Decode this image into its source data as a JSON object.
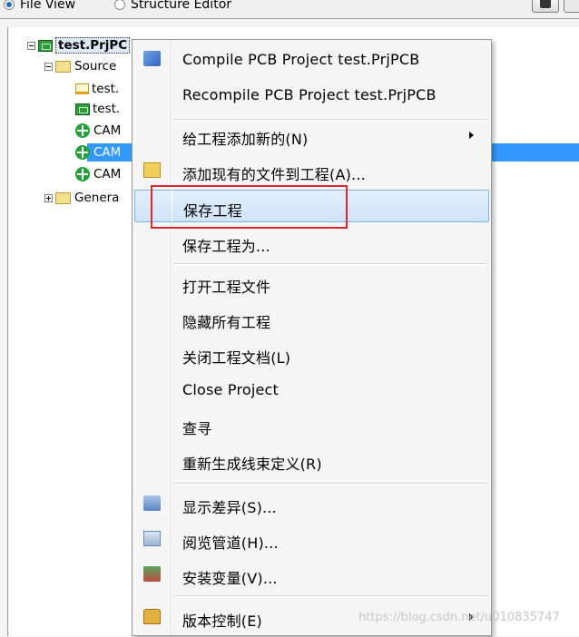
{
  "view_toggle": {
    "file_view": "File View",
    "structure_editor": "Structure Editor",
    "selected": "File View"
  },
  "tree": {
    "project": "test.PrjPC",
    "source_folder": "Source",
    "items": [
      "test.",
      "test.",
      "CAM",
      "CAM",
      "CAM"
    ],
    "generated_folder": "Genera"
  },
  "context_menu": {
    "items": [
      {
        "label": "Compile PCB Project test.PrjPCB",
        "icon": "compile-icon"
      },
      {
        "label": "Recompile PCB Project test.PrjPCB"
      },
      {
        "label": "给工程添加新的(N)",
        "submenu": true
      },
      {
        "label": "添加现有的文件到工程(A)...",
        "icon": "add-existing-icon"
      },
      {
        "label": "保存工程",
        "highlighted": true
      },
      {
        "label": "保存工程为..."
      },
      {
        "label": "打开工程文件"
      },
      {
        "label": "隐藏所有工程"
      },
      {
        "label": "关闭工程文档(L)"
      },
      {
        "label": "Close Project"
      },
      {
        "label": "查寻"
      },
      {
        "label": "重新生成线束定义(R)"
      },
      {
        "label": "显示差异(S)...",
        "icon": "diff-icon"
      },
      {
        "label": "阅览管道(H)...",
        "icon": "browse-icon"
      },
      {
        "label": "安装变量(V)...",
        "icon": "install-icon"
      },
      {
        "label": "版本控制(E)",
        "icon": "lock-icon",
        "submenu": true
      }
    ]
  },
  "watermark": "https://blog.csdn.net/u010835747",
  "colors": {
    "highlight_border": "#e0262b",
    "selection": "#3399ff"
  }
}
